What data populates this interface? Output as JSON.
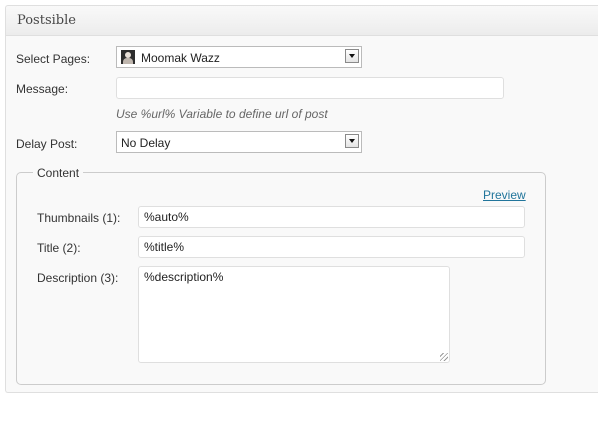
{
  "panel": {
    "title": "Postsible"
  },
  "form": {
    "select_pages": {
      "label": "Select Pages:",
      "value": "Moomak Wazz"
    },
    "message": {
      "label": "Message:",
      "value": "",
      "hint": "Use %url% Variable to define url of post"
    },
    "delay_post": {
      "label": "Delay Post:",
      "value": "No Delay"
    }
  },
  "content": {
    "legend": "Content",
    "preview_link": "Preview",
    "thumbnails": {
      "label": "Thumbnails (1):",
      "value": "%auto%"
    },
    "title": {
      "label": "Title (2):",
      "value": "%title%"
    },
    "description": {
      "label": "Description (3):",
      "value": "%description%"
    }
  },
  "icons": {
    "avatar": "user-avatar-icon",
    "dropdown": "chevron-down-icon"
  },
  "colors": {
    "link": "#21759b",
    "border": "#dfdfdf",
    "panel_bg": "#f9f9f9"
  }
}
